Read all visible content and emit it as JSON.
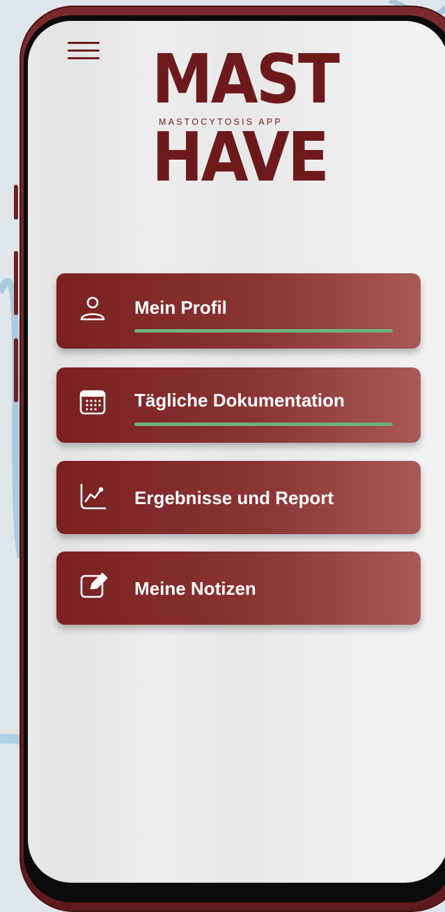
{
  "app": {
    "logo_line1": "MAST",
    "logo_subtitle": "MASTOCYTOSIS APP",
    "logo_line2": "HAVE"
  },
  "colors": {
    "brand": "#6e1a1c",
    "card_gradient_start": "#7a2021",
    "card_gradient_end": "#a95858",
    "progress": "#6fb27a",
    "text_on_card": "#ffffff"
  },
  "menu": {
    "icon": "hamburger-menu-icon",
    "items": [
      {
        "label": "Mein Profil",
        "icon": "user-profile-icon",
        "progress": 1.0
      },
      {
        "label": "Tägliche Dokumentation",
        "icon": "calendar-icon",
        "progress": 1.0
      },
      {
        "label": "Ergebnisse und Report",
        "icon": "chart-line-icon"
      },
      {
        "label": "Meine Notizen",
        "icon": "edit-note-icon"
      }
    ]
  }
}
